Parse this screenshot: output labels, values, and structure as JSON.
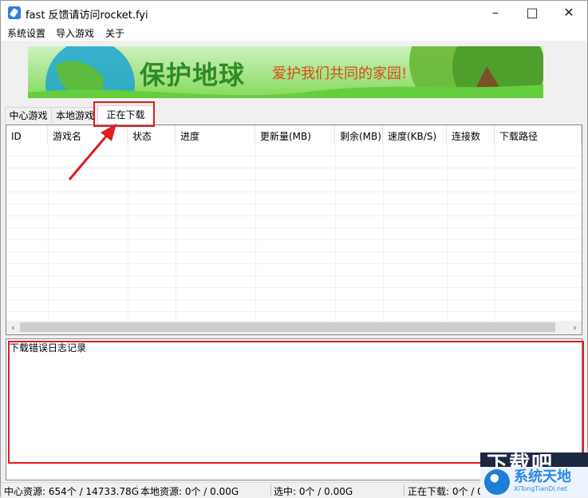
{
  "window": {
    "title": "fast 反馈请访问rocket.fyi",
    "minimize": "–",
    "maximize": "□",
    "close": "✕"
  },
  "menu": [
    "系统设置",
    "导入游戏",
    "关于"
  ],
  "banner": {
    "title": "保护地球",
    "subtitle": "爱护我们共同的家园!"
  },
  "tabs": [
    "中心游戏",
    "本地游戏",
    "正在下载"
  ],
  "active_tab": "正在下载",
  "table": {
    "columns": [
      "ID",
      "游戏名",
      "状态",
      "进度",
      "更新量(MB)",
      "剩余(MB)",
      "速度(KB/S)",
      "连接数",
      "下载路径"
    ],
    "rows": []
  },
  "scroll": {
    "left": "‹",
    "right": "›"
  },
  "log": {
    "label": "下载错误日志记录"
  },
  "status": {
    "center": "中心资源: 654个 / 14733.78G",
    "local": "本地资源: 0个 / 0.00G",
    "selected": "选中: 0个 / 0.00G",
    "downloading": "正在下载: 0个 / 0"
  },
  "watermark": {
    "top": "下载吧",
    "name": "系统天地",
    "site": "XiTongTianDi.net"
  },
  "colors": {
    "highlight": "#e01d1d",
    "banner_green": "#2f8a24",
    "banner_orange": "#d34b17"
  }
}
